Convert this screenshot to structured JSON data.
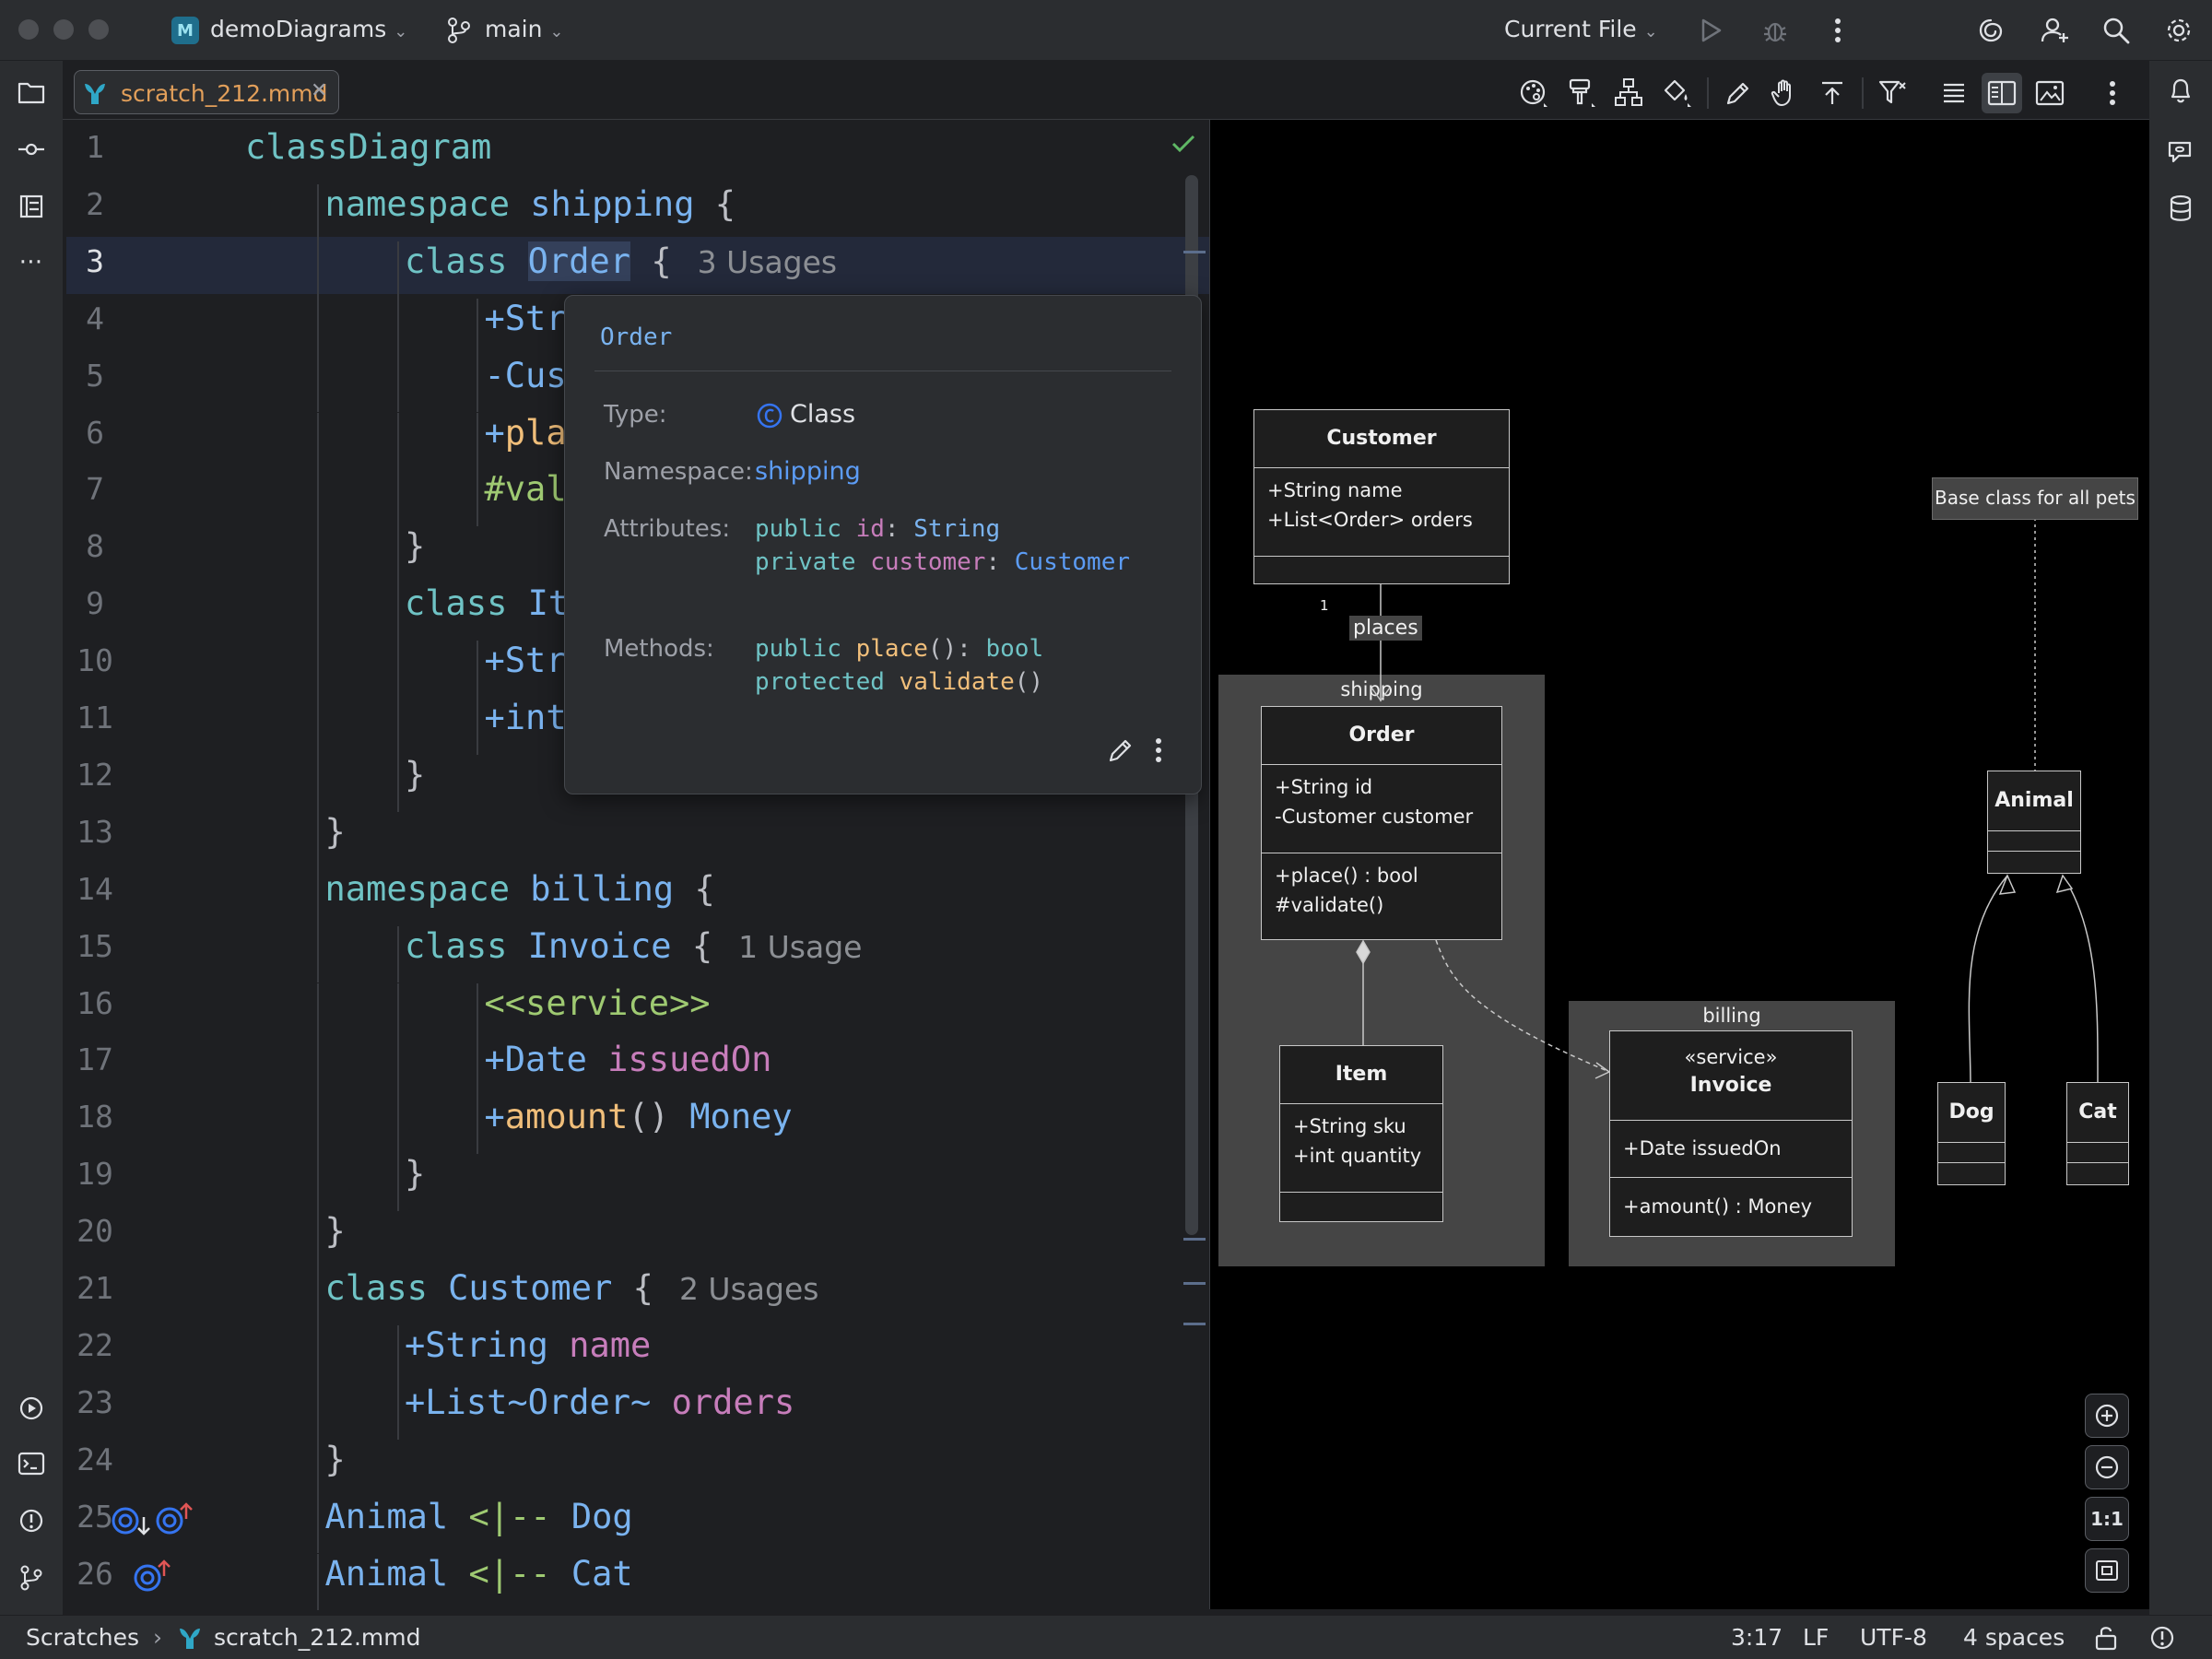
{
  "titlebar": {
    "project": "demoDiagrams",
    "branch": "main",
    "run_config": "Current File"
  },
  "tab": {
    "filename": "scratch_212.mmd"
  },
  "editor": {
    "lines": [
      {
        "n": "1",
        "indent": 0,
        "tokens": [
          [
            "kw",
            "classDiagram"
          ]
        ]
      },
      {
        "n": "2",
        "indent": 1,
        "tokens": [
          [
            "kw",
            "namespace "
          ],
          [
            "cls",
            "shipping"
          ],
          [
            "op",
            " {"
          ]
        ]
      },
      {
        "n": "3",
        "indent": 2,
        "tokens": [
          [
            "kw",
            "class "
          ],
          [
            "cls",
            "Order"
          ],
          [
            "op",
            " {"
          ]
        ],
        "hint": "3 Usages"
      },
      {
        "n": "4",
        "indent": 3,
        "tokens": [
          [
            "cls",
            "+Str"
          ]
        ]
      },
      {
        "n": "5",
        "indent": 3,
        "tokens": [
          [
            "cls",
            "-Cus"
          ]
        ]
      },
      {
        "n": "6",
        "indent": 3,
        "tokens": [
          [
            "cls",
            "+"
          ],
          [
            "mth",
            "pla"
          ]
        ]
      },
      {
        "n": "7",
        "indent": 3,
        "tokens": [
          [
            "str",
            "#val"
          ]
        ]
      },
      {
        "n": "8",
        "indent": 2,
        "tokens": [
          [
            "op",
            "}"
          ]
        ]
      },
      {
        "n": "9",
        "indent": 2,
        "tokens": [
          [
            "kw",
            "class "
          ],
          [
            "cls",
            "It"
          ]
        ]
      },
      {
        "n": "10",
        "indent": 3,
        "tokens": [
          [
            "cls",
            "+Str"
          ]
        ]
      },
      {
        "n": "11",
        "indent": 3,
        "tokens": [
          [
            "cls",
            "+int"
          ]
        ]
      },
      {
        "n": "12",
        "indent": 2,
        "tokens": [
          [
            "op",
            "}"
          ]
        ]
      },
      {
        "n": "13",
        "indent": 1,
        "tokens": [
          [
            "op",
            "}"
          ]
        ]
      },
      {
        "n": "14",
        "indent": 1,
        "tokens": [
          [
            "kw",
            "namespace "
          ],
          [
            "cls",
            "billing"
          ],
          [
            "op",
            " {"
          ]
        ]
      },
      {
        "n": "15",
        "indent": 2,
        "tokens": [
          [
            "kw",
            "class "
          ],
          [
            "cls",
            "Invoice"
          ],
          [
            "op",
            " {"
          ]
        ],
        "hint": "1 Usage"
      },
      {
        "n": "16",
        "indent": 3,
        "tokens": [
          [
            "str",
            "<<service>>"
          ]
        ]
      },
      {
        "n": "17",
        "indent": 3,
        "tokens": [
          [
            "cls",
            "+Date "
          ],
          [
            "fld",
            "issuedOn"
          ]
        ]
      },
      {
        "n": "18",
        "indent": 3,
        "tokens": [
          [
            "cls",
            "+"
          ],
          [
            "mth",
            "amount"
          ],
          [
            "op",
            "() "
          ],
          [
            "cls",
            "Money"
          ]
        ]
      },
      {
        "n": "19",
        "indent": 2,
        "tokens": [
          [
            "op",
            "}"
          ]
        ]
      },
      {
        "n": "20",
        "indent": 1,
        "tokens": [
          [
            "op",
            "}"
          ]
        ]
      },
      {
        "n": "21",
        "indent": 1,
        "tokens": [
          [
            "kw",
            "class "
          ],
          [
            "cls",
            "Customer"
          ],
          [
            "op",
            " {"
          ]
        ],
        "hint": "2 Usages"
      },
      {
        "n": "22",
        "indent": 2,
        "tokens": [
          [
            "cls",
            "+String "
          ],
          [
            "fld",
            "name"
          ]
        ]
      },
      {
        "n": "23",
        "indent": 2,
        "tokens": [
          [
            "cls",
            "+List~Order~ "
          ],
          [
            "fld",
            "orders"
          ]
        ]
      },
      {
        "n": "24",
        "indent": 1,
        "tokens": [
          [
            "op",
            "}"
          ]
        ]
      },
      {
        "n": "25",
        "indent": 1,
        "tokens": [
          [
            "cls",
            "Animal "
          ],
          [
            "str",
            "<|-- "
          ],
          [
            "cls",
            "Dog"
          ]
        ]
      },
      {
        "n": "26",
        "indent": 1,
        "tokens": [
          [
            "cls",
            "Animal "
          ],
          [
            "str",
            "<|-- "
          ],
          [
            "cls",
            "Cat"
          ]
        ]
      }
    ]
  },
  "popup": {
    "title": "Order",
    "type_label": "Type:",
    "type_value": "Class",
    "namespace_label": "Namespace:",
    "namespace_value": "shipping",
    "attributes_label": "Attributes:",
    "attr1": {
      "mod": "public ",
      "name": "id",
      "sep": ": ",
      "type": "String"
    },
    "attr2": {
      "mod": "private ",
      "name": "customer",
      "sep": ": ",
      "type": "Customer"
    },
    "methods_label": "Methods:",
    "m1": {
      "mod": "public ",
      "name": "place",
      "rest": "(): ",
      "type": "bool"
    },
    "m2": {
      "mod": "protected ",
      "name": "validate",
      "rest": "()"
    }
  },
  "diagram": {
    "customer": {
      "name": "Customer",
      "attrs": [
        "+String name",
        "+List<Order> orders"
      ]
    },
    "relation_label": "places",
    "relation_mult": "1",
    "shipping": "shipping",
    "order": {
      "name": "Order",
      "attrs": [
        "+String id",
        "-Customer customer"
      ],
      "methods": [
        "+place() : bool",
        "#validate()"
      ]
    },
    "item": {
      "name": "Item",
      "attrs": [
        "+String sku",
        "+int quantity"
      ]
    },
    "billing": "billing",
    "invoice": {
      "stereotype": "«service»",
      "name": "Invoice",
      "attrs": [
        "+Date issuedOn"
      ],
      "methods": [
        "+amount() : Money"
      ]
    },
    "note": "Base class for all pets",
    "animal": {
      "name": "Animal"
    },
    "dog": {
      "name": "Dog"
    },
    "cat": {
      "name": "Cat"
    },
    "zoom_reset": "1:1"
  },
  "statusbar": {
    "breadcrumb_root": "Scratches",
    "breadcrumb_file": "scratch_212.mmd",
    "position": "3:17",
    "line_sep": "LF",
    "encoding": "UTF-8",
    "indent": "4 spaces"
  },
  "colors": {
    "keyword": "#6fc3c5",
    "class": "#7ab3ef",
    "field": "#c77dbb",
    "method": "#f0be7a",
    "string": "#9fca72",
    "accent": "#3574f0"
  }
}
